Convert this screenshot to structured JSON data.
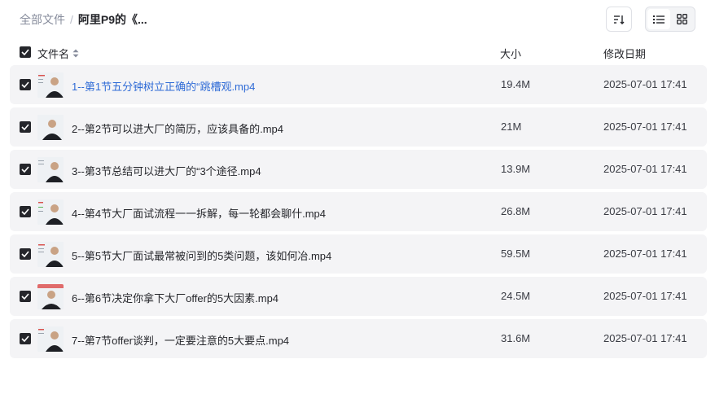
{
  "breadcrumb": {
    "root": "全部文件",
    "separator": "/",
    "current": "阿里P9的《..."
  },
  "table": {
    "headers": {
      "name": "文件名",
      "size": "大小",
      "modified": "修改日期"
    },
    "rows": [
      {
        "name": "1--第1节五分钟树立正确的“跳槽观.mp4",
        "size": "19.4M",
        "modified": "2025-07-01 17:41"
      },
      {
        "name": "2--第2节可以进大厂的简历，应该具备的.mp4",
        "size": "21M",
        "modified": "2025-07-01 17:41"
      },
      {
        "name": "3--第3节总结可以进大厂的“3个途径.mp4",
        "size": "13.9M",
        "modified": "2025-07-01 17:41"
      },
      {
        "name": "4--第4节大厂面试流程一一拆解，每一轮都会聊什.mp4",
        "size": "26.8M",
        "modified": "2025-07-01 17:41"
      },
      {
        "name": "5--第5节大厂面试最常被问到的5类问题，该如何冶.mp4",
        "size": "59.5M",
        "modified": "2025-07-01 17:41"
      },
      {
        "name": "6--第6节决定你拿下大厂offer的5大因素.mp4",
        "size": "24.5M",
        "modified": "2025-07-01 17:41"
      },
      {
        "name": "7--第7节offer谈判，一定要注意的5大要点.mp4",
        "size": "31.6M",
        "modified": "2025-07-01 17:41"
      }
    ]
  },
  "colors": {
    "accent": "#2f6bd6",
    "row_bg": "#f4f4f6",
    "checkbox": "#25262b"
  },
  "icons": {
    "sort": "sort-icon",
    "list_view": "list-view-icon",
    "grid_view": "grid-view-icon",
    "header_sort": "sort-arrows-icon"
  }
}
